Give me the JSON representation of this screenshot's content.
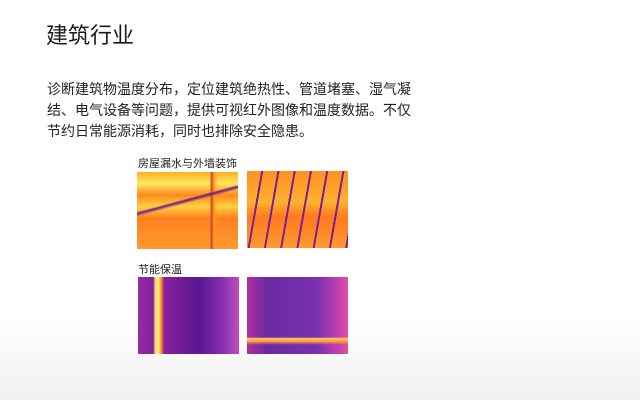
{
  "title": "建筑行业",
  "description": "诊断建筑物温度分布，定位建筑绝热性、管道堵塞、湿气凝结、电气设备等问题，提供可视红外图像和温度数据。不仅节约日常能源消耗，同时也排除安全隐患。",
  "sections": [
    {
      "caption": "房屋漏水与外墙装饰"
    },
    {
      "caption": "节能保温"
    }
  ]
}
